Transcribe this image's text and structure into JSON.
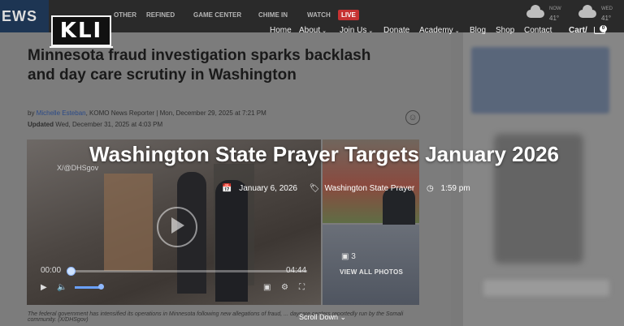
{
  "background_site": {
    "brand": "EWS",
    "nav": [
      "OTHER",
      "REFINED",
      "GAME CENTER",
      "CHIME IN",
      "WATCH"
    ],
    "live_label": "LIVE",
    "weather": [
      {
        "label": "NOW",
        "temp": "41°"
      },
      {
        "label": "WED",
        "temp": "41°"
      }
    ],
    "headline_line1": "Minnesota fraud investigation sparks backlash",
    "headline_line2": "and day care scrutiny in Washington",
    "byline_prefix": "by ",
    "author": "Michelle Esteban",
    "byline_suffix": ", KOMO News Reporter | Mon, December 29, 2025 at 7:21 PM",
    "updated_label": "Updated",
    "updated_value": "Wed, December 31, 2025 at 4:03 PM",
    "video": {
      "watermark": "X/@DHSgov",
      "current_time": "00:00",
      "duration": "04:44",
      "progress": 0.0,
      "volume": 0.75
    },
    "gallery": {
      "photo_count": "3",
      "view_all_label": "VIEW ALL PHOTOS"
    },
    "caption": "The federal government has intensified its operations in Minnesota following new allegations of fraud, ... daycare centers reportedly run by the Somali community. (X/DHSgov)"
  },
  "site": {
    "logo": "KLI",
    "nav": [
      {
        "label": "Home",
        "has_dropdown": false
      },
      {
        "label": "About",
        "has_dropdown": true
      },
      {
        "label": "Join Us",
        "has_dropdown": true
      },
      {
        "label": "Donate",
        "has_dropdown": false
      },
      {
        "label": "Academy",
        "has_dropdown": true
      },
      {
        "label": "Blog",
        "has_dropdown": false
      },
      {
        "label": "Shop",
        "has_dropdown": false
      },
      {
        "label": "Contact",
        "has_dropdown": false
      }
    ],
    "cart_label": "Cart/",
    "cart_count": "0",
    "accent_color": "#ffffff"
  },
  "event": {
    "title": "Washington State Prayer Targets January 2026",
    "date": "January 6, 2026",
    "category": "Washington State Prayer",
    "time": "1:59 pm",
    "scroll_label": "Scroll Down"
  }
}
